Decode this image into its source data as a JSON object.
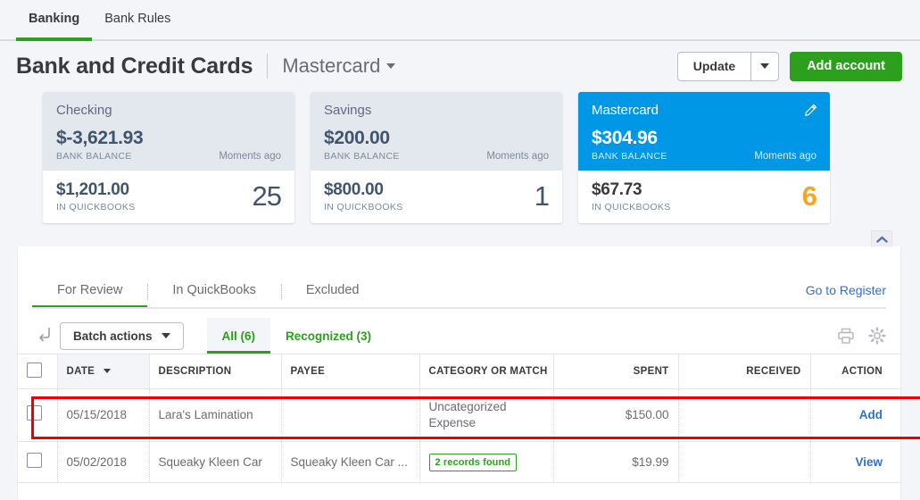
{
  "topnav": {
    "tabs": [
      {
        "label": "Banking",
        "active": true
      },
      {
        "label": "Bank Rules",
        "active": false
      }
    ]
  },
  "header": {
    "title": "Bank and Credit Cards",
    "account_selector": "Mastercard",
    "update_label": "Update",
    "add_account_label": "Add account"
  },
  "cards": [
    {
      "name": "Checking",
      "bank_balance": "$-3,621.93",
      "bank_balance_label": "BANK BALANCE",
      "updated": "Moments ago",
      "qb_balance": "$1,201.00",
      "qb_label": "IN QUICKBOOKS",
      "count": "25",
      "selected": false
    },
    {
      "name": "Savings",
      "bank_balance": "$200.00",
      "bank_balance_label": "BANK BALANCE",
      "updated": "Moments ago",
      "qb_balance": "$800.00",
      "qb_label": "IN QUICKBOOKS",
      "count": "1",
      "selected": false
    },
    {
      "name": "Mastercard",
      "bank_balance": "$304.96",
      "bank_balance_label": "BANK BALANCE",
      "updated": "Moments ago",
      "qb_balance": "$67.73",
      "qb_label": "IN QUICKBOOKS",
      "count": "6",
      "selected": true
    }
  ],
  "panel": {
    "subtabs": [
      {
        "label": "For Review",
        "active": true
      },
      {
        "label": "In QuickBooks",
        "active": false
      },
      {
        "label": "Excluded",
        "active": false
      }
    ],
    "go_to_register": "Go to Register",
    "toolbar": {
      "batch_actions_label": "Batch actions",
      "filter_tabs": [
        {
          "label": "All (6)",
          "active": true
        },
        {
          "label": "Recognized (3)",
          "active": false
        }
      ]
    },
    "table": {
      "columns": [
        "DATE",
        "DESCRIPTION",
        "PAYEE",
        "CATEGORY OR MATCH",
        "SPENT",
        "RECEIVED",
        "ACTION"
      ],
      "rows": [
        {
          "date": "05/15/2018",
          "description": "Lara's Lamination",
          "payee": "",
          "category": "Uncategorized Expense",
          "category_badge": "",
          "spent": "$150.00",
          "received": "",
          "action": "Add"
        },
        {
          "date": "05/02/2018",
          "description": "Squeaky Kleen Car",
          "payee": "Squeaky Kleen Car ...",
          "category": "",
          "category_badge": "2 records found",
          "spent": "$19.99",
          "received": "",
          "action": "View"
        }
      ]
    }
  },
  "colors": {
    "brand_green": "#2ca01c",
    "selected_card_blue": "#0097e6",
    "link_blue": "#2e70d2",
    "count_orange": "#f5a623",
    "highlight_red": "#ee0000"
  }
}
